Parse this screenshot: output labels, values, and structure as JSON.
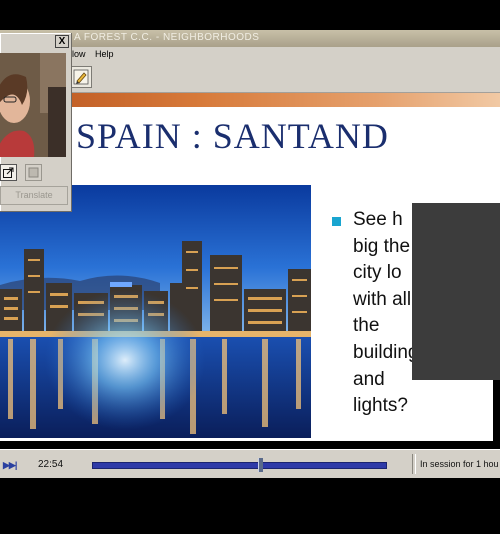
{
  "window": {
    "title": "A FOREST C.C. - NEIGHBORHOODS"
  },
  "menu": {
    "items": [
      "low",
      "Help"
    ]
  },
  "toolbar": {
    "button_icon": "edit-pencil-icon"
  },
  "slide": {
    "title": "SPAIN : SANTAND",
    "bullet": "See how big the city looks with all of the buildings and lights?",
    "bullet_lines": [
      "See h",
      "big the",
      "city lo",
      "with all of",
      "the",
      "buildings",
      "and",
      "lights?"
    ],
    "image": "city-skyline-night-photo"
  },
  "player": {
    "time": "22:54",
    "progress": 0.57,
    "session_text": "In session for 1 hou",
    "play_icon": "play-icon"
  },
  "pip": {
    "close_label": "X",
    "translate_label": "Translate",
    "video": "webcam-video-feed",
    "icons": [
      "popout-icon",
      "toggle-icon"
    ]
  },
  "colors": {
    "title_blue": "#1a2e6e",
    "bullet_cyan": "#19a5d0",
    "stripe_orange": "#b8531e",
    "progress_blue": "#2e3aa8"
  }
}
